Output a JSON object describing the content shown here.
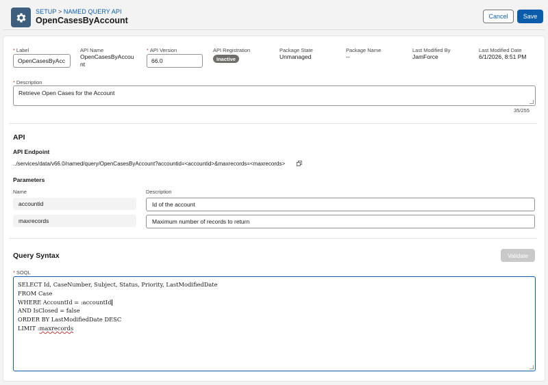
{
  "header": {
    "breadcrumb": {
      "parent": "SETUP",
      "separator": ">",
      "current": "NAMED QUERY API"
    },
    "title": "OpenCasesByAccount",
    "cancel_label": "Cancel",
    "save_label": "Save"
  },
  "details": {
    "label": {
      "label": "Label",
      "value": "OpenCasesByAcc"
    },
    "api_name": {
      "label": "API Name",
      "value_line1": "OpenCasesByAccou",
      "value_line2": "nt"
    },
    "api_version": {
      "label": "API Version",
      "value": "66.0"
    },
    "api_registration": {
      "label": "API Registration",
      "value": "Inactive"
    },
    "package_state": {
      "label": "Package State",
      "value": "Unmanaged"
    },
    "package_name": {
      "label": "Package Name",
      "value": "--"
    },
    "last_modified_by": {
      "label": "Last Modified By",
      "value": "JamForce"
    },
    "last_modified_date": {
      "label": "Last Modified Date",
      "value": "6/1/2026, 8:51 PM"
    },
    "description": {
      "label": "Description",
      "value": "Retrieve Open Cases for the Account",
      "count": "35/255"
    }
  },
  "api": {
    "section_title": "API",
    "endpoint_title": "API Endpoint",
    "endpoint": "../services/data/v66.0/named/query/OpenCasesByAccount?accountid=<accountid>&maxrecords=<maxrecords>",
    "parameters_title": "Parameters",
    "col_name": "Name",
    "col_description": "Description",
    "params": [
      {
        "name": "accountid",
        "description": "Id of the account"
      },
      {
        "name": "maxrecords",
        "description": "Maximum number of records to return"
      }
    ]
  },
  "query": {
    "section_title": "Query Syntax",
    "validate_label": "Validate",
    "soql_label": "SOQL",
    "lines": [
      "SELECT Id, CaseNumber, Subject, Status, Priority, LastModifiedDate",
      "FROM Case",
      "WHERE AccountId = :accountId",
      "AND IsClosed = false",
      "ORDER BY LastModifiedDate DESC",
      "LIMIT :maxrecords"
    ]
  },
  "colors": {
    "brand": "#0b5cab",
    "required": "#c23934",
    "badge": "#706e6b",
    "icon_bg": "#3e5e7e"
  },
  "icons": {
    "header": "gear-icon",
    "copy": "copy-icon"
  }
}
